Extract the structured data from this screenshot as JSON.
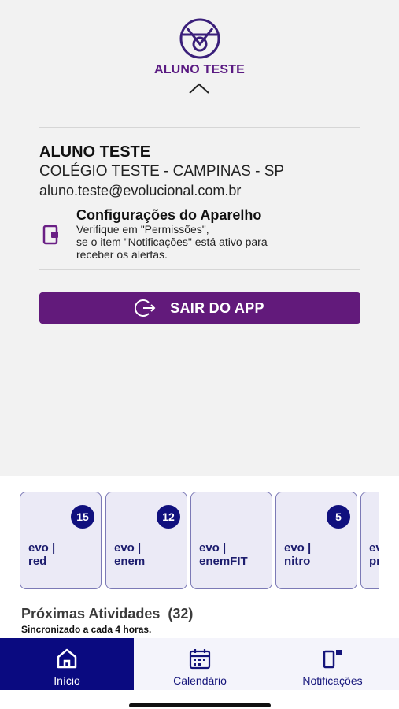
{
  "header": {
    "name": "ALUNO TESTE"
  },
  "profile": {
    "name": "ALUNO TESTE",
    "school": "COLÉGIO TESTE - CAMPINAS - SP",
    "email": "aluno.teste@evolucional.com.br"
  },
  "settings": {
    "title": "Configurações do Aparelho",
    "text": "Verifique em \"Permissões\",\nse o item \"Notificações\" está ativo para\nreceber os alertas.",
    "icon": "device-settings-icon"
  },
  "logout": {
    "label": "SAIR DO APP",
    "icon": "logout-icon"
  },
  "cards": [
    {
      "label": "evo |\nred",
      "badge": "15"
    },
    {
      "label": "evo |\nenem",
      "badge": "12"
    },
    {
      "label": "evo |\nenemFIT",
      "badge": ""
    },
    {
      "label": "evo |\nnitro",
      "badge": "5"
    },
    {
      "label": "ev\npr",
      "badge": ""
    }
  ],
  "activities": {
    "title": "Próximas Atividades  (32)",
    "subtitle": "Sincronizado a cada 4 horas."
  },
  "tabs": [
    {
      "label": "Início",
      "icon": "home-icon",
      "active": true
    },
    {
      "label": "Calendário",
      "icon": "calendar-icon",
      "active": false
    },
    {
      "label": "Notificações",
      "icon": "notifications-icon",
      "active": false
    }
  ],
  "colors": {
    "brand_purple": "#621a7b",
    "navy": "#0a0a80",
    "panel_bg": "#f2f2f2"
  }
}
